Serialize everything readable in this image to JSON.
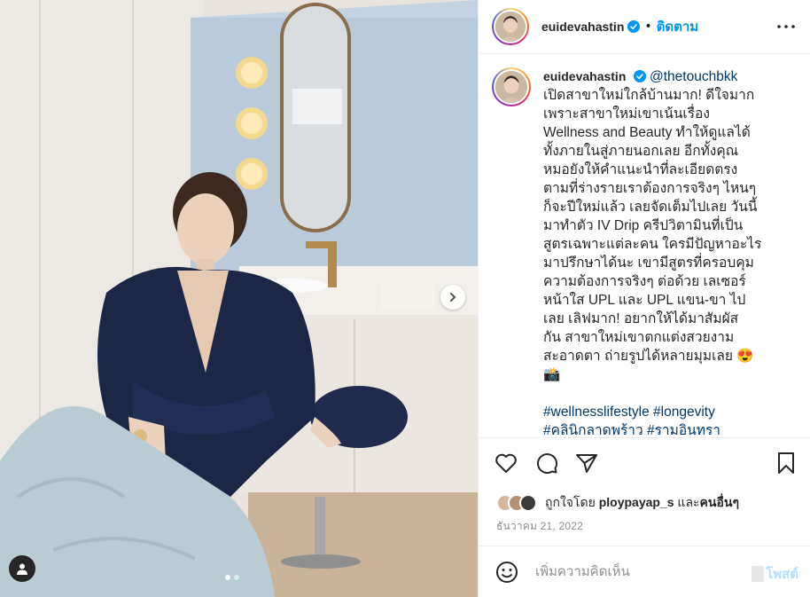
{
  "post": {
    "username": "euidevahastin",
    "follow_label": "ติดตาม",
    "bullet": "•",
    "caption": {
      "username": "euidevahastin",
      "mention": "@thetouchbkk",
      "lines": [
        "เปิดสาขาใหม่ใกล้บ้านมาก! ดีใจมาก",
        "เพราะสาขาใหม่เขาเน้นเรื่อง",
        "Wellness and Beauty ทำให้ดูแลได้",
        "ทั้งภายในสู่ภายนอกเลย อีกทั้งคุณ",
        "หมอยังให้คำแนะนำที่ละเอียดตรง",
        "ตามที่ร่างรายเราต้องการจริงๆ ไหนๆ",
        "ก็จะปีใหม่แล้ว เลยจัดเต็มไปเลย วันนี้",
        "มาทำตัว IV Drip ครีปวิตามินที่เป็น",
        "สูตรเฉพาะแต่ละคน ใครมีปัญหาอะไร",
        "มาปรึกษาได้นะ เขามีสูตรที่ครอบคุม",
        "ความต้องการจริงๆ ต่อด้วย เลเซอร์",
        "หน้าใส UPL และ UPL แขน-ขา ไป",
        "เลย เลิฟมาก! อยากให้ได้มาสัมผัส",
        "กัน สาขาใหม่เขาตกแต่งสวยงาม",
        "สะอาดตา ถ่ายรูปได้หลายมุมเลย 😍",
        "📸"
      ],
      "hashtag_lines": [
        "#wellnesslifestyle #longevity",
        "#คลินิกลาดพร้าว #รามอินทรา"
      ]
    },
    "likes": {
      "prefix": "ถูกใจโดย",
      "user": "ploypayap_s",
      "joiner": "และ",
      "others": "คนอื่นๆ"
    },
    "date": "ธันวาคม 21, 2022",
    "comment": {
      "placeholder": "เพิ่มความคิดเห็น",
      "post_label": "โพสต์"
    },
    "carousel": {
      "total": 2,
      "current": 1
    },
    "icons": [
      "verified-badge-icon",
      "more-options-icon",
      "heart-icon",
      "comment-icon",
      "share-icon",
      "save-bookmark-icon",
      "emoji-icon",
      "next-arrow-icon",
      "user-tag-icon"
    ],
    "colors": {
      "accent": "#0095f6",
      "link": "#00376b",
      "muted": "#8e8e8e",
      "post_disabled": "#b2dffc"
    }
  }
}
